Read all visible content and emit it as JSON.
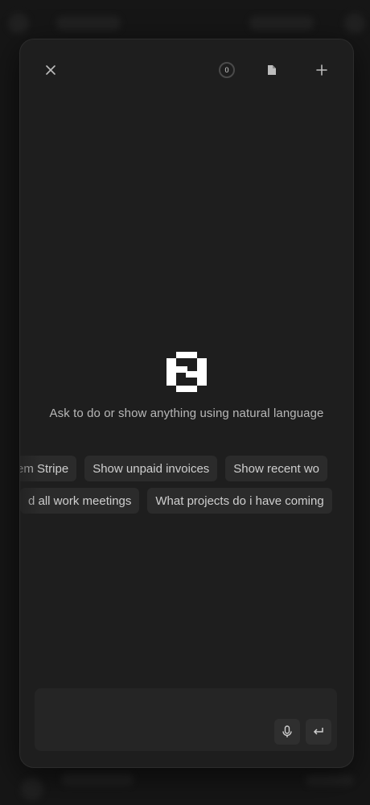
{
  "modal": {
    "counter_value": "0",
    "headline": "Ask to do or show anything using natural language",
    "suggestions_row1": [
      "em Stripe",
      "Show unpaid invoices",
      "Show recent wo"
    ],
    "suggestions_row2": [
      "d all work meetings",
      "What projects do i have coming"
    ],
    "composer": {
      "placeholder": ""
    }
  },
  "icons": {
    "close": "close-icon",
    "counter": "counter-badge",
    "document": "document-icon",
    "add": "plus-icon",
    "logo": "app-logo",
    "mic": "microphone-icon",
    "enter": "enter-return-icon"
  },
  "colors": {
    "background": "#161616",
    "modal": "#1e1e1e",
    "chip": "#2b2b2b",
    "text": "#cfcfcf"
  }
}
